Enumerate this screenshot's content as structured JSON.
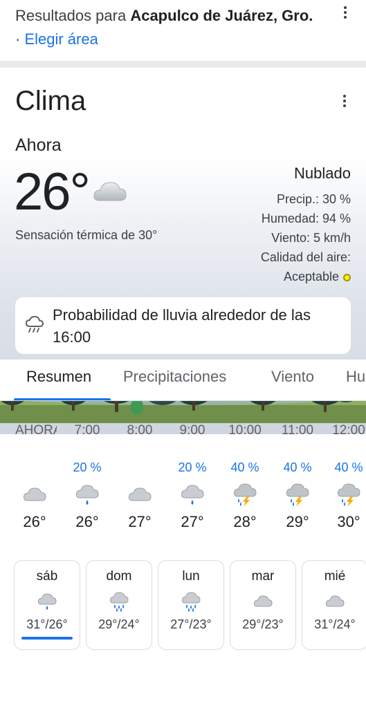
{
  "header": {
    "results_prefix": "Resultados para ",
    "location": "Acapulco de Juárez, Gro.",
    "separator": " · ",
    "area_link": "Elegir área"
  },
  "weather": {
    "title": "Clima",
    "now_label": "Ahora",
    "temperature": "26°",
    "feels_like": "Sensación térmica de 30°",
    "condition": "Nublado",
    "precip": "Precip.: 30 %",
    "humidity": "Humedad: 94 %",
    "wind": "Viento: 5 km/h",
    "air_quality_label": "Calidad del aire:",
    "air_quality_value": "Aceptable",
    "air_quality_color": "#fff200",
    "rain_banner": "Probabilidad de lluvia alrededor de las 16:00"
  },
  "tabs": [
    {
      "label": "Resumen",
      "active": true
    },
    {
      "label": "Precipitaciones",
      "active": false
    },
    {
      "label": "Viento",
      "active": false
    },
    {
      "label": "Hu",
      "active": false
    }
  ],
  "hourly": [
    {
      "time": "AHORA",
      "prob": "",
      "icon": "cloud-icon",
      "temp": "26°"
    },
    {
      "time": "7:00",
      "prob": "20 %",
      "icon": "rain-icon",
      "temp": "26°"
    },
    {
      "time": "8:00",
      "prob": "",
      "icon": "cloud-icon",
      "temp": "27°"
    },
    {
      "time": "9:00",
      "prob": "20 %",
      "icon": "rain-icon",
      "temp": "27°"
    },
    {
      "time": "10:00",
      "prob": "40 %",
      "icon": "thunderstorm-icon",
      "temp": "28°"
    },
    {
      "time": "11:00",
      "prob": "40 %",
      "icon": "thunderstorm-icon",
      "temp": "29°"
    },
    {
      "time": "12:00",
      "prob": "40 %",
      "icon": "thunderstorm-icon",
      "temp": "30°"
    }
  ],
  "daily": [
    {
      "day": "sáb",
      "icon": "rain-icon",
      "temps": "31°/26°",
      "selected": true
    },
    {
      "day": "dom",
      "icon": "heavy-rain-icon",
      "temps": "29°/24°",
      "selected": false
    },
    {
      "day": "lun",
      "icon": "heavy-rain-icon",
      "temps": "27°/23°",
      "selected": false
    },
    {
      "day": "mar",
      "icon": "cloud-icon",
      "temps": "29°/23°",
      "selected": false
    },
    {
      "day": "mié",
      "icon": "cloud-icon",
      "temps": "31°/24°",
      "selected": false
    }
  ],
  "colors": {
    "accent": "#1a73e8",
    "lightning": "#f9ab00",
    "rain_drop": "#1a73e8"
  }
}
